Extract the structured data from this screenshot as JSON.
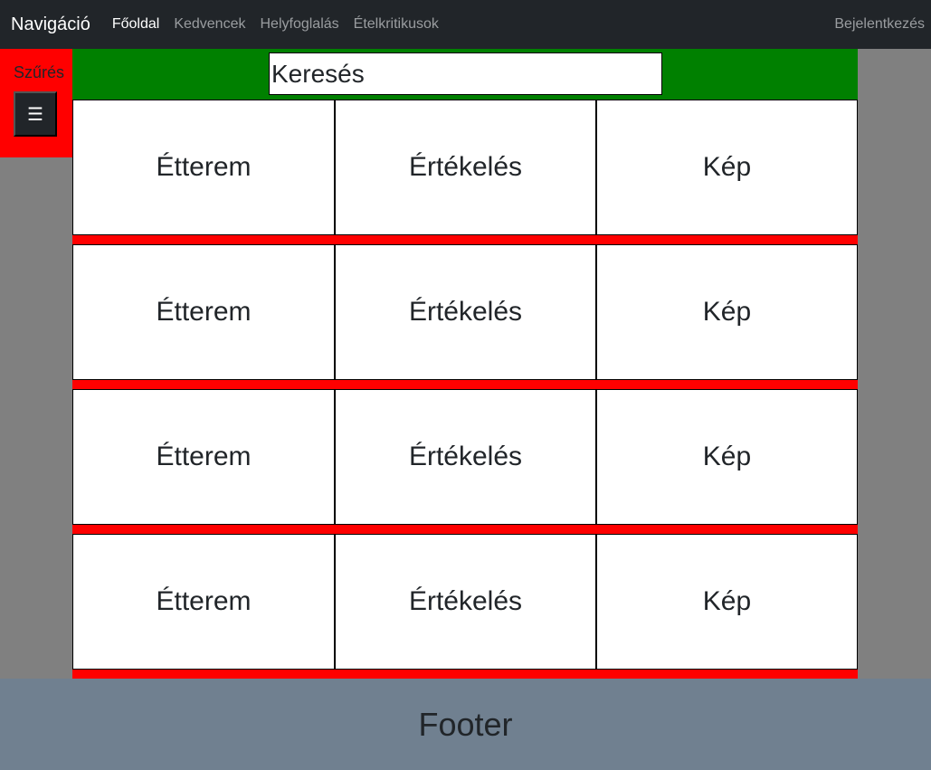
{
  "navbar": {
    "brand": "Navigáció",
    "links": [
      {
        "label": "Főoldal",
        "active": true
      },
      {
        "label": "Kedvencek",
        "active": false
      },
      {
        "label": "Helyfoglalás",
        "active": false
      },
      {
        "label": "Ételkritikusok",
        "active": false
      }
    ],
    "login": "Bejelentkezés"
  },
  "filter": {
    "label": "Szűrés",
    "toggle_icon": "hamburger-icon",
    "toggle_glyph": "☰"
  },
  "search": {
    "placeholder": "Keresés"
  },
  "rows": [
    {
      "restaurant": "Étterem",
      "rating": "Értékelés",
      "image": "Kép"
    },
    {
      "restaurant": "Étterem",
      "rating": "Értékelés",
      "image": "Kép"
    },
    {
      "restaurant": "Étterem",
      "rating": "Értékelés",
      "image": "Kép"
    },
    {
      "restaurant": "Étterem",
      "rating": "Értékelés",
      "image": "Kép"
    }
  ],
  "footer": {
    "text": "Footer"
  },
  "colors": {
    "navbar_bg": "#212529",
    "filter_bg": "#ff0000",
    "search_bg": "#008000",
    "row_bg": "#ff0000",
    "page_bg": "#808080",
    "footer_bg": "#708090"
  }
}
